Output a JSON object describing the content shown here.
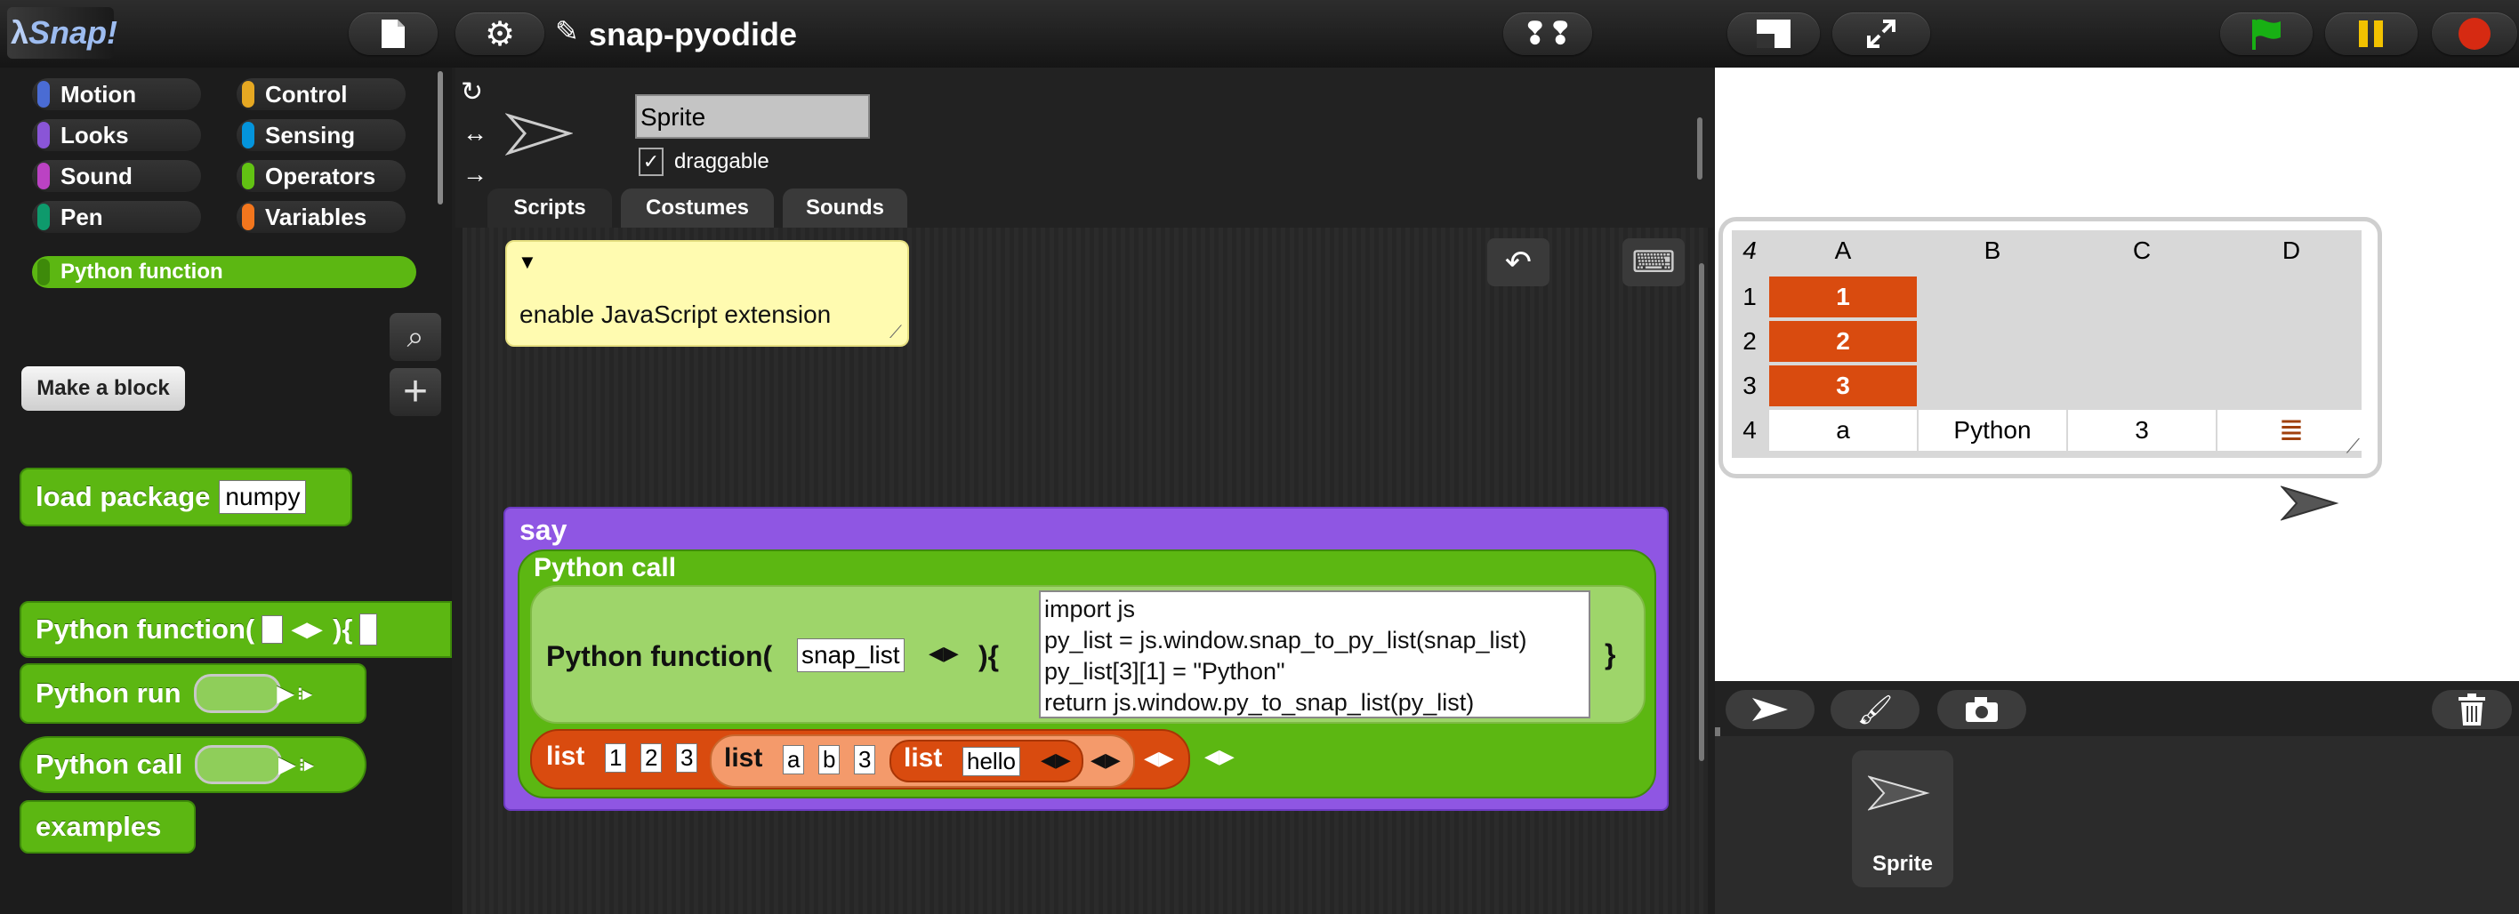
{
  "app": {
    "logo_text": "Snap!",
    "project_name": "snap-pyodide"
  },
  "categories": {
    "col1": [
      {
        "label": "Motion",
        "color": "#4a6cd4"
      },
      {
        "label": "Looks",
        "color": "#8a55d7"
      },
      {
        "label": "Sound",
        "color": "#bb42c3"
      },
      {
        "label": "Pen",
        "color": "#0e9a6c"
      }
    ],
    "col2": [
      {
        "label": "Control",
        "color": "#e6a822"
      },
      {
        "label": "Sensing",
        "color": "#0494dc"
      },
      {
        "label": "Operators",
        "color": "#62c213"
      },
      {
        "label": "Variables",
        "color": "#f3761d"
      }
    ],
    "custom": {
      "label": "Python function",
      "color": "#5cb712"
    }
  },
  "palette": {
    "make_block_label": "Make a block",
    "load_package": {
      "label": "load package",
      "value": "numpy"
    },
    "python_function": {
      "label": "Python function(",
      "close": "){"
    },
    "python_run": {
      "label": "Python run"
    },
    "python_call": {
      "label": "Python call"
    },
    "examples": {
      "label": "examples"
    }
  },
  "sprite": {
    "name": "Sprite",
    "draggable_label": "draggable",
    "draggable_checked": "✓"
  },
  "tabs": [
    "Scripts",
    "Costumes",
    "Sounds"
  ],
  "comment": {
    "text": "enable JavaScript  extension"
  },
  "script": {
    "say": "say",
    "python_call": "Python call",
    "python_function": "Python function(",
    "param": "snap_list",
    "brace_open": "){",
    "brace_close": "}",
    "code": [
      "import js",
      "py_list = js.window.snap_to_py_list(snap_list)",
      "py_list[3][1] = \"Python\"",
      "return  js.window.py_to_snap_list(py_list)"
    ],
    "list_label": "list",
    "outer_items": [
      "1",
      "2",
      "3"
    ],
    "inner_items": [
      "a",
      "b",
      "3"
    ],
    "innermost_item": "hello"
  },
  "table": {
    "corner": "4",
    "columns": [
      "A",
      "B",
      "C",
      "D"
    ],
    "rows": [
      {
        "num": "1",
        "cells": [
          "1",
          "",
          "",
          ""
        ]
      },
      {
        "num": "2",
        "cells": [
          "2",
          "",
          "",
          ""
        ]
      },
      {
        "num": "3",
        "cells": [
          "3",
          "",
          "",
          ""
        ]
      },
      {
        "num": "4",
        "cells": [
          "a",
          "Python",
          "3",
          "≣"
        ]
      }
    ]
  },
  "corral": {
    "sprite_label": "Sprite"
  },
  "colors": {
    "accent_green": "#5cb712",
    "say_purple": "#8f56e3",
    "list_orange": "#d94b0f",
    "stop_red": "#d62a12",
    "pause_yellow": "#f2c200",
    "flag_green": "#18b014"
  }
}
